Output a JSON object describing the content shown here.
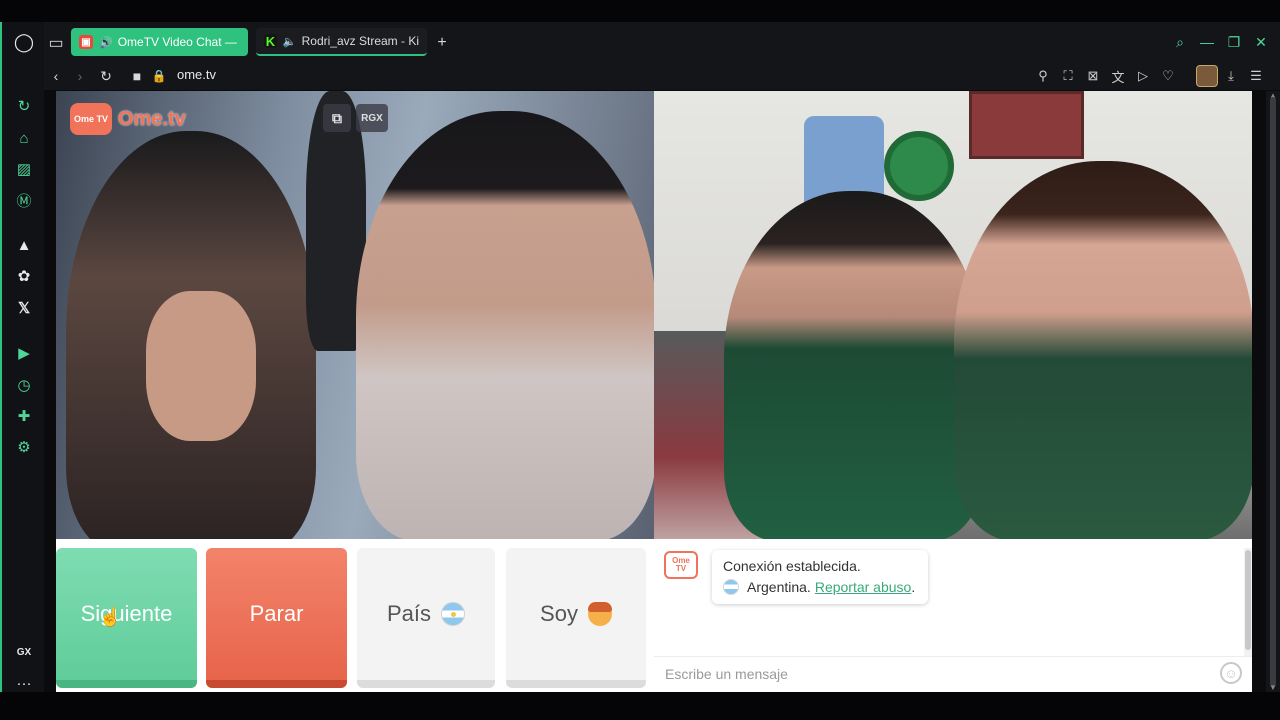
{
  "browser": {
    "tabs": [
      {
        "title": "OmeTV Video Chat —",
        "active": true
      },
      {
        "title": "Rodri_avz Stream - Ki",
        "active": false
      }
    ],
    "new_tab_label": "+",
    "url": "ome.tv",
    "sidebar_bottom_label": "GX",
    "sidebar_more": "···",
    "accent_color": "#2ec27e"
  },
  "page": {
    "logo_text": "Ome.tv",
    "logo_badge": "Ome TV",
    "video_controls": {
      "rgx_label": "RGX"
    },
    "buttons": {
      "next": "Siguiente",
      "stop": "Parar",
      "country": "País",
      "soy": "Soy"
    },
    "chat": {
      "logo_badge": "Ome TV",
      "status_message": "Conexión establecida.",
      "country_text": "Argentina.",
      "report_link": "Reportar abuso",
      "report_suffix": ".",
      "input_placeholder": "Escribe un mensaje"
    }
  }
}
